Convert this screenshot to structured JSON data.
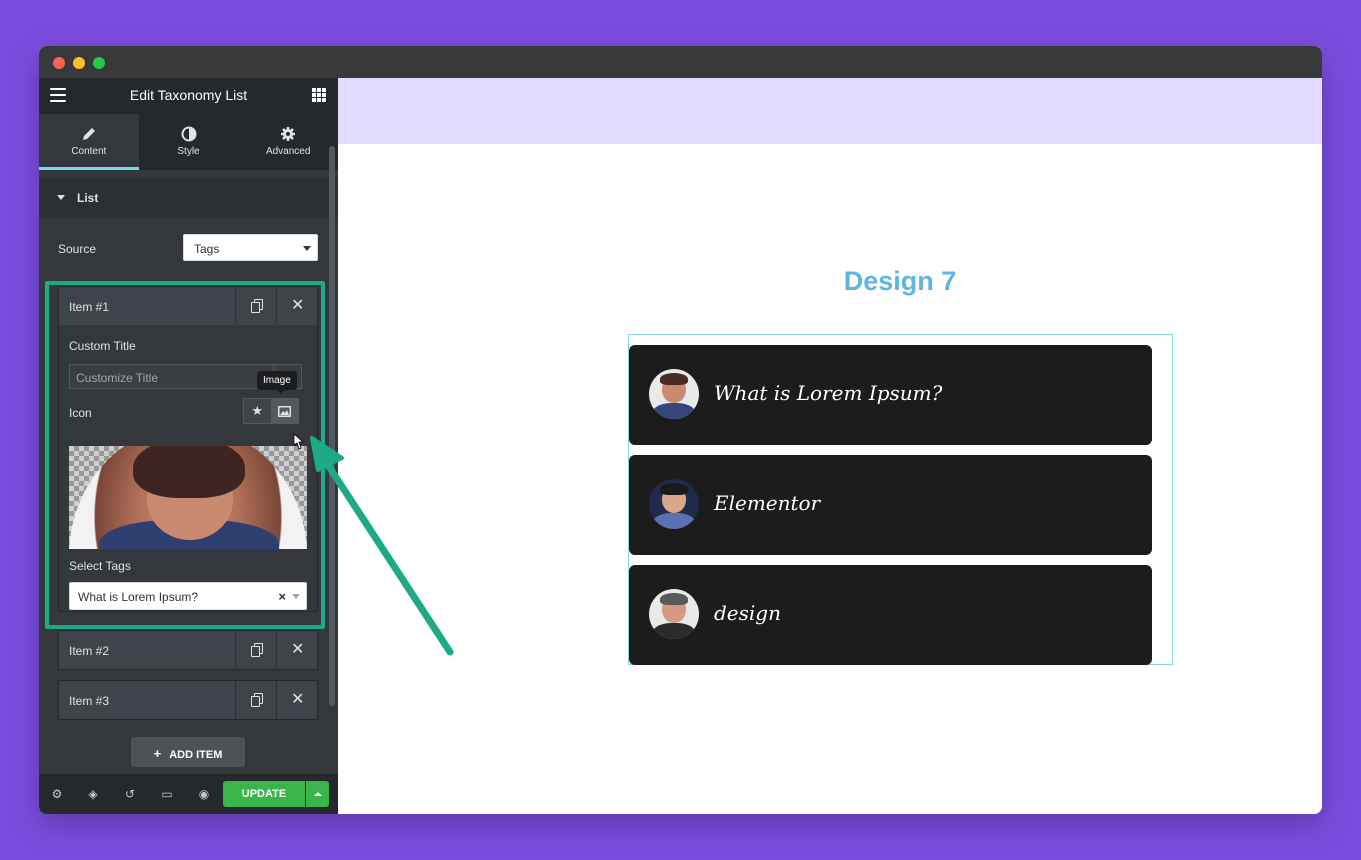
{
  "window": {
    "title_bar": ""
  },
  "panel": {
    "title": "Edit Taxonomy List",
    "tabs": [
      {
        "label": "Content",
        "icon": "pencil-icon",
        "active": true
      },
      {
        "label": "Style",
        "icon": "half-circle-icon",
        "active": false
      },
      {
        "label": "Advanced",
        "icon": "gear-icon",
        "active": false
      }
    ],
    "section": {
      "title": "List"
    },
    "source": {
      "label": "Source",
      "value": "Tags"
    },
    "items": [
      {
        "label": "Item #1",
        "expanded": true,
        "custom_title_label": "Custom Title",
        "custom_title_placeholder": "Customize Title",
        "icon_label": "Icon",
        "icon_tooltip": "Image",
        "select_tags_label": "Select Tags",
        "select_tags_value": "What is Lorem Ipsum?"
      },
      {
        "label": "Item #2",
        "expanded": false
      },
      {
        "label": "Item #3",
        "expanded": false
      }
    ],
    "add_item_label": "ADD ITEM",
    "footer": {
      "update_label": "UPDATE"
    }
  },
  "canvas": {
    "heading": "Design 7",
    "list": [
      {
        "text": "What is Lorem Ipsum?",
        "avatar": "man-portrait"
      },
      {
        "text": "Elementor",
        "avatar": "woman-portrait"
      },
      {
        "text": "design",
        "avatar": "bearded-man-portrait"
      }
    ]
  },
  "colors": {
    "background": "#7b4ddf",
    "accent": "#1eaa87",
    "heading": "#5fb4e0",
    "update": "#39b54a"
  }
}
